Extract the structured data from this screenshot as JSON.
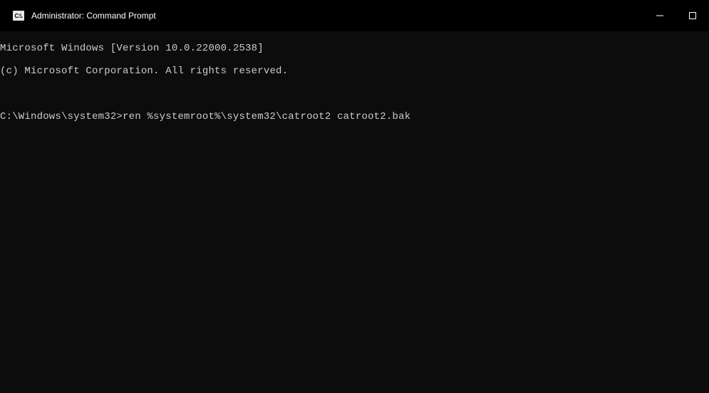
{
  "window": {
    "title": "Administrator: Command Prompt",
    "icon_label": "C:\\."
  },
  "terminal": {
    "line1": "Microsoft Windows [Version 10.0.22000.2538]",
    "line2": "(c) Microsoft Corporation. All rights reserved.",
    "blank": "",
    "prompt": "C:\\Windows\\system32>",
    "command": "ren %systemroot%\\system32\\catroot2 catroot2.bak"
  }
}
